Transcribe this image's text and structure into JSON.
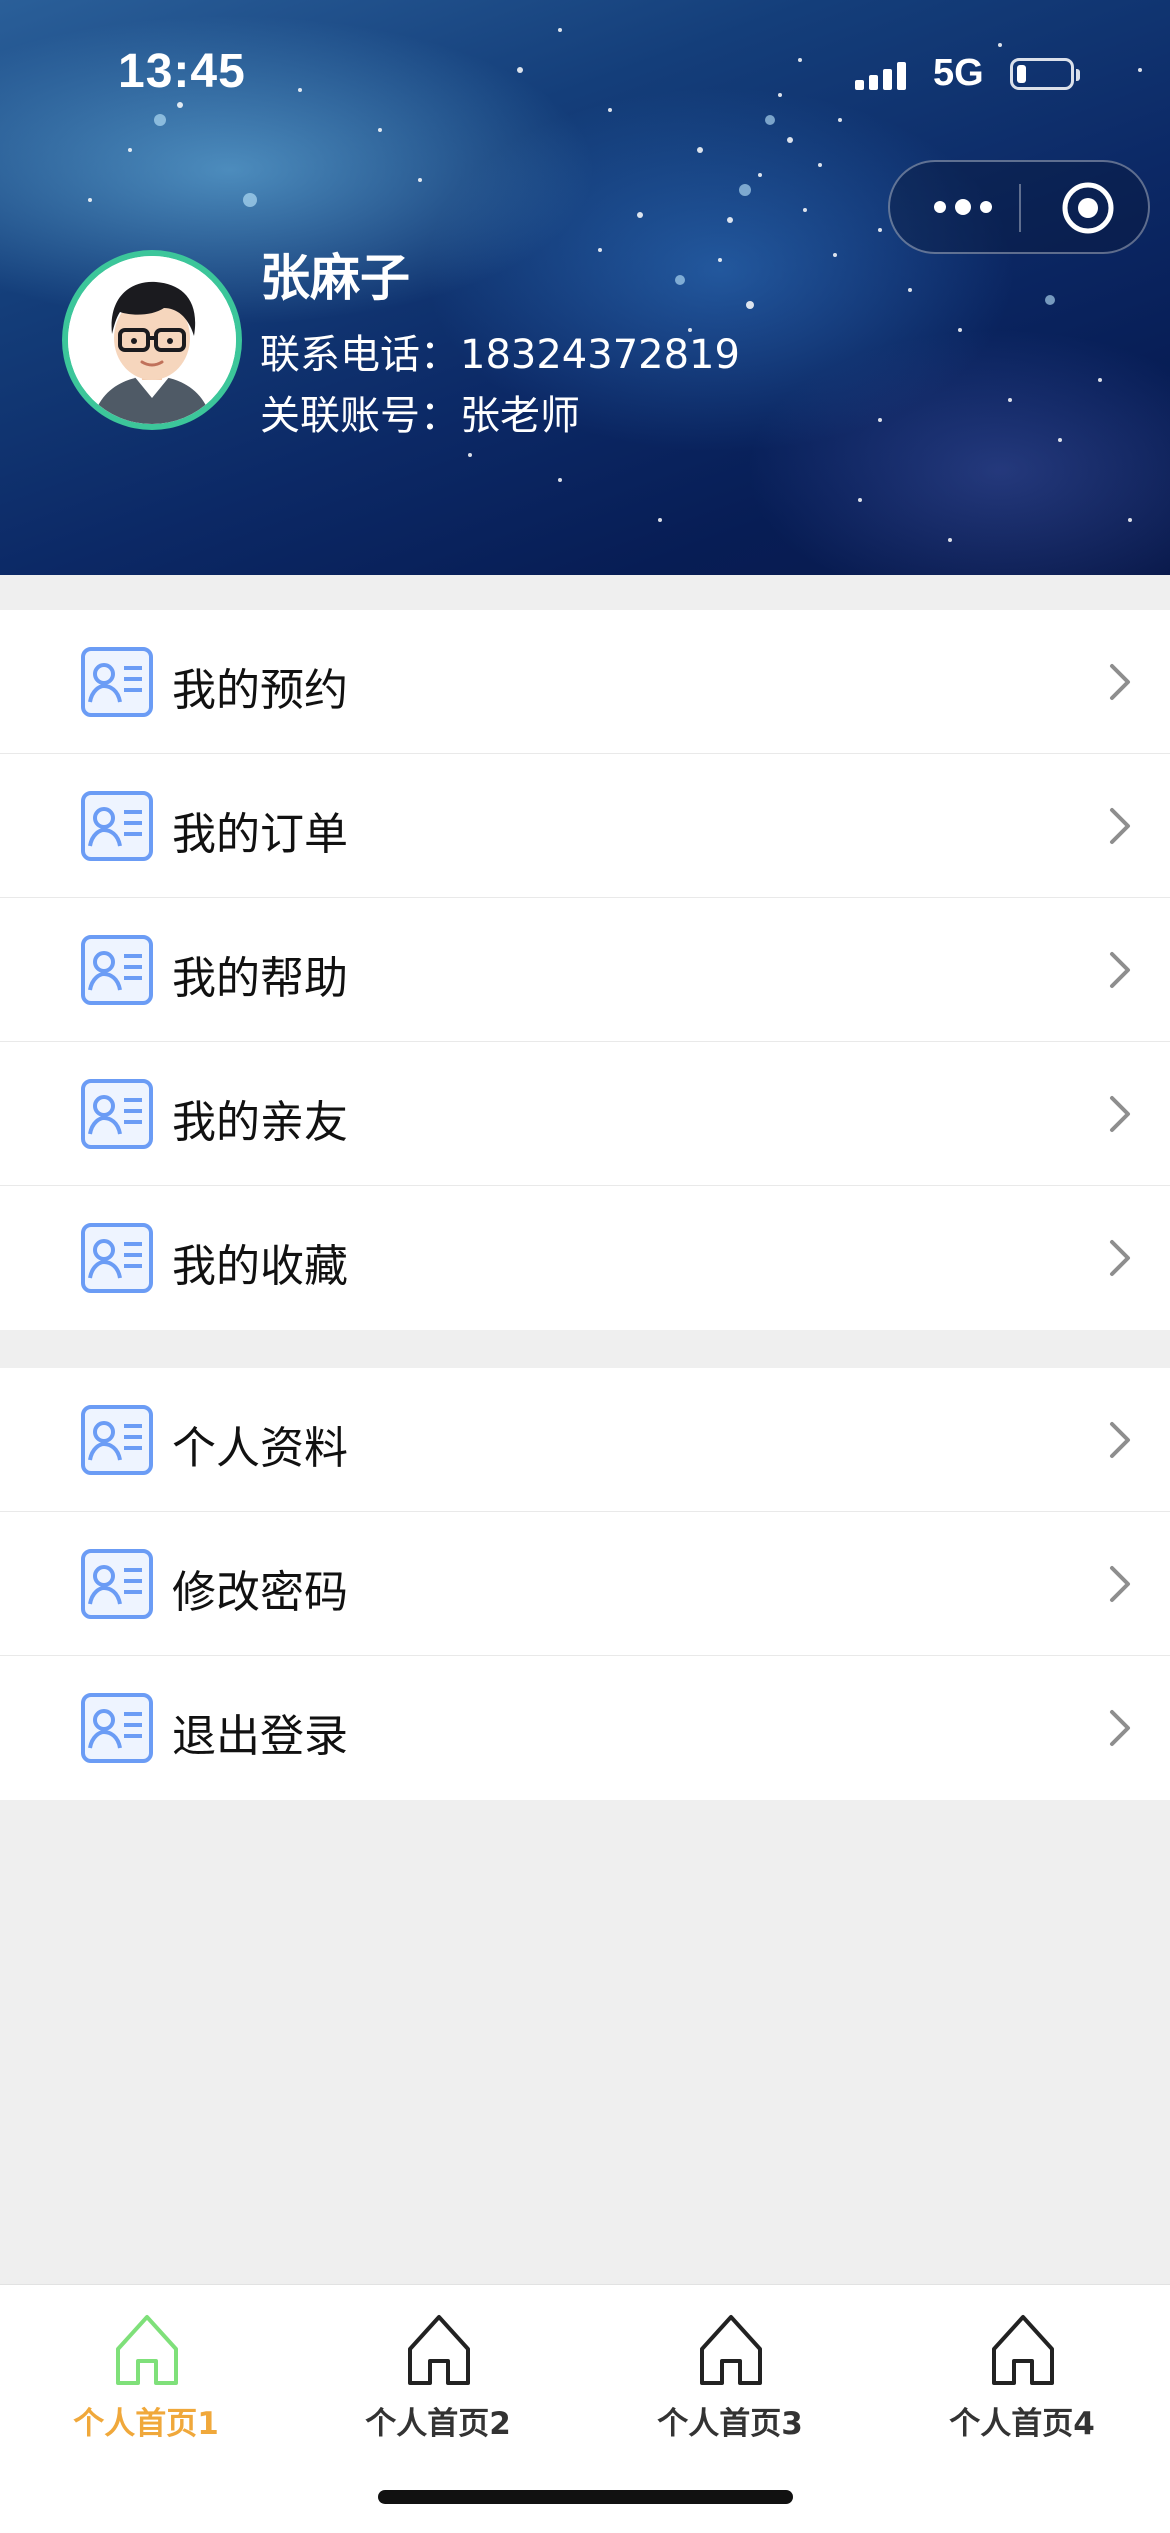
{
  "status_bar": {
    "time": "13:45",
    "network": "5G"
  },
  "capsule": {
    "more_icon": "more-dots-icon",
    "close_icon": "target-close-icon"
  },
  "profile": {
    "name": "张麻子",
    "phone_line": "联系电话：18324372819",
    "account_line": "关联账号：张老师",
    "avatar": "cartoon-avatar-with-glasses"
  },
  "menu_groups": [
    {
      "items": [
        {
          "label": "我的预约",
          "icon": "contact-card-icon"
        },
        {
          "label": "我的订单",
          "icon": "contact-card-icon"
        },
        {
          "label": "我的帮助",
          "icon": "contact-card-icon"
        },
        {
          "label": "我的亲友",
          "icon": "contact-card-icon"
        },
        {
          "label": "我的收藏",
          "icon": "contact-card-icon"
        }
      ]
    },
    {
      "items": [
        {
          "label": "个人资料",
          "icon": "contact-card-icon"
        },
        {
          "label": "修改密码",
          "icon": "contact-card-icon"
        },
        {
          "label": "退出登录",
          "icon": "contact-card-icon"
        }
      ]
    }
  ],
  "tabs": [
    {
      "label": "个人首页1",
      "icon": "home-icon",
      "active": true
    },
    {
      "label": "个人首页2",
      "icon": "home-icon",
      "active": false
    },
    {
      "label": "个人首页3",
      "icon": "home-icon",
      "active": false
    },
    {
      "label": "个人首页4",
      "icon": "home-icon",
      "active": false
    }
  ],
  "colors": {
    "tab_active": "#f0a83b",
    "tab_active_icon": "#7fe07a",
    "menu_icon": "#5b8ff0",
    "avatar_ring": "#3cc69a"
  }
}
